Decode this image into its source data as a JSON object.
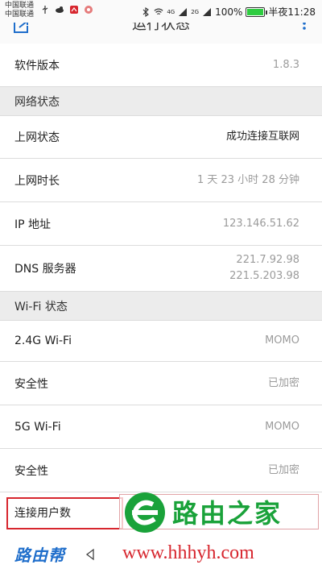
{
  "status": {
    "carrier1": "中国联通",
    "carrier2": "中国联通",
    "net1": "4G",
    "net2": "2G",
    "battery": "100%",
    "battery_level": 1.0,
    "time": "半夜11:28"
  },
  "header": {
    "title": "运行状态"
  },
  "rows": {
    "software_version": {
      "label": "软件版本",
      "value": "1.8.3"
    },
    "online_status": {
      "label": "上网状态",
      "value": "成功连接互联网"
    },
    "online_duration": {
      "label": "上网时长",
      "value": "1 天 23 小时 28 分钟"
    },
    "ip": {
      "label": "IP 地址",
      "value": "123.146.51.62"
    },
    "dns": {
      "label": "DNS 服务器",
      "value1": "221.7.92.98",
      "value2": "221.5.203.98"
    },
    "wifi24": {
      "label": "2.4G Wi-Fi",
      "value": "MOMO"
    },
    "sec1": {
      "label": "安全性",
      "value": "已加密"
    },
    "wifi5": {
      "label": "5G Wi-Fi",
      "value": "MOMO"
    },
    "sec2": {
      "label": "安全性",
      "value": "已加密"
    },
    "users": {
      "label": "连接用户数"
    }
  },
  "sections": {
    "network": "网络状态",
    "wifi": "Wi-Fi 状态"
  },
  "watermark": {
    "title": "路由之家",
    "url": "www.hhhyh.com",
    "left_logo": "路由帮"
  },
  "colors": {
    "highlight": "#d7262e",
    "watermark_green": "#1aa23a",
    "watermark_red": "#d7262e",
    "left_logo_blue": "#1f6ecb"
  }
}
